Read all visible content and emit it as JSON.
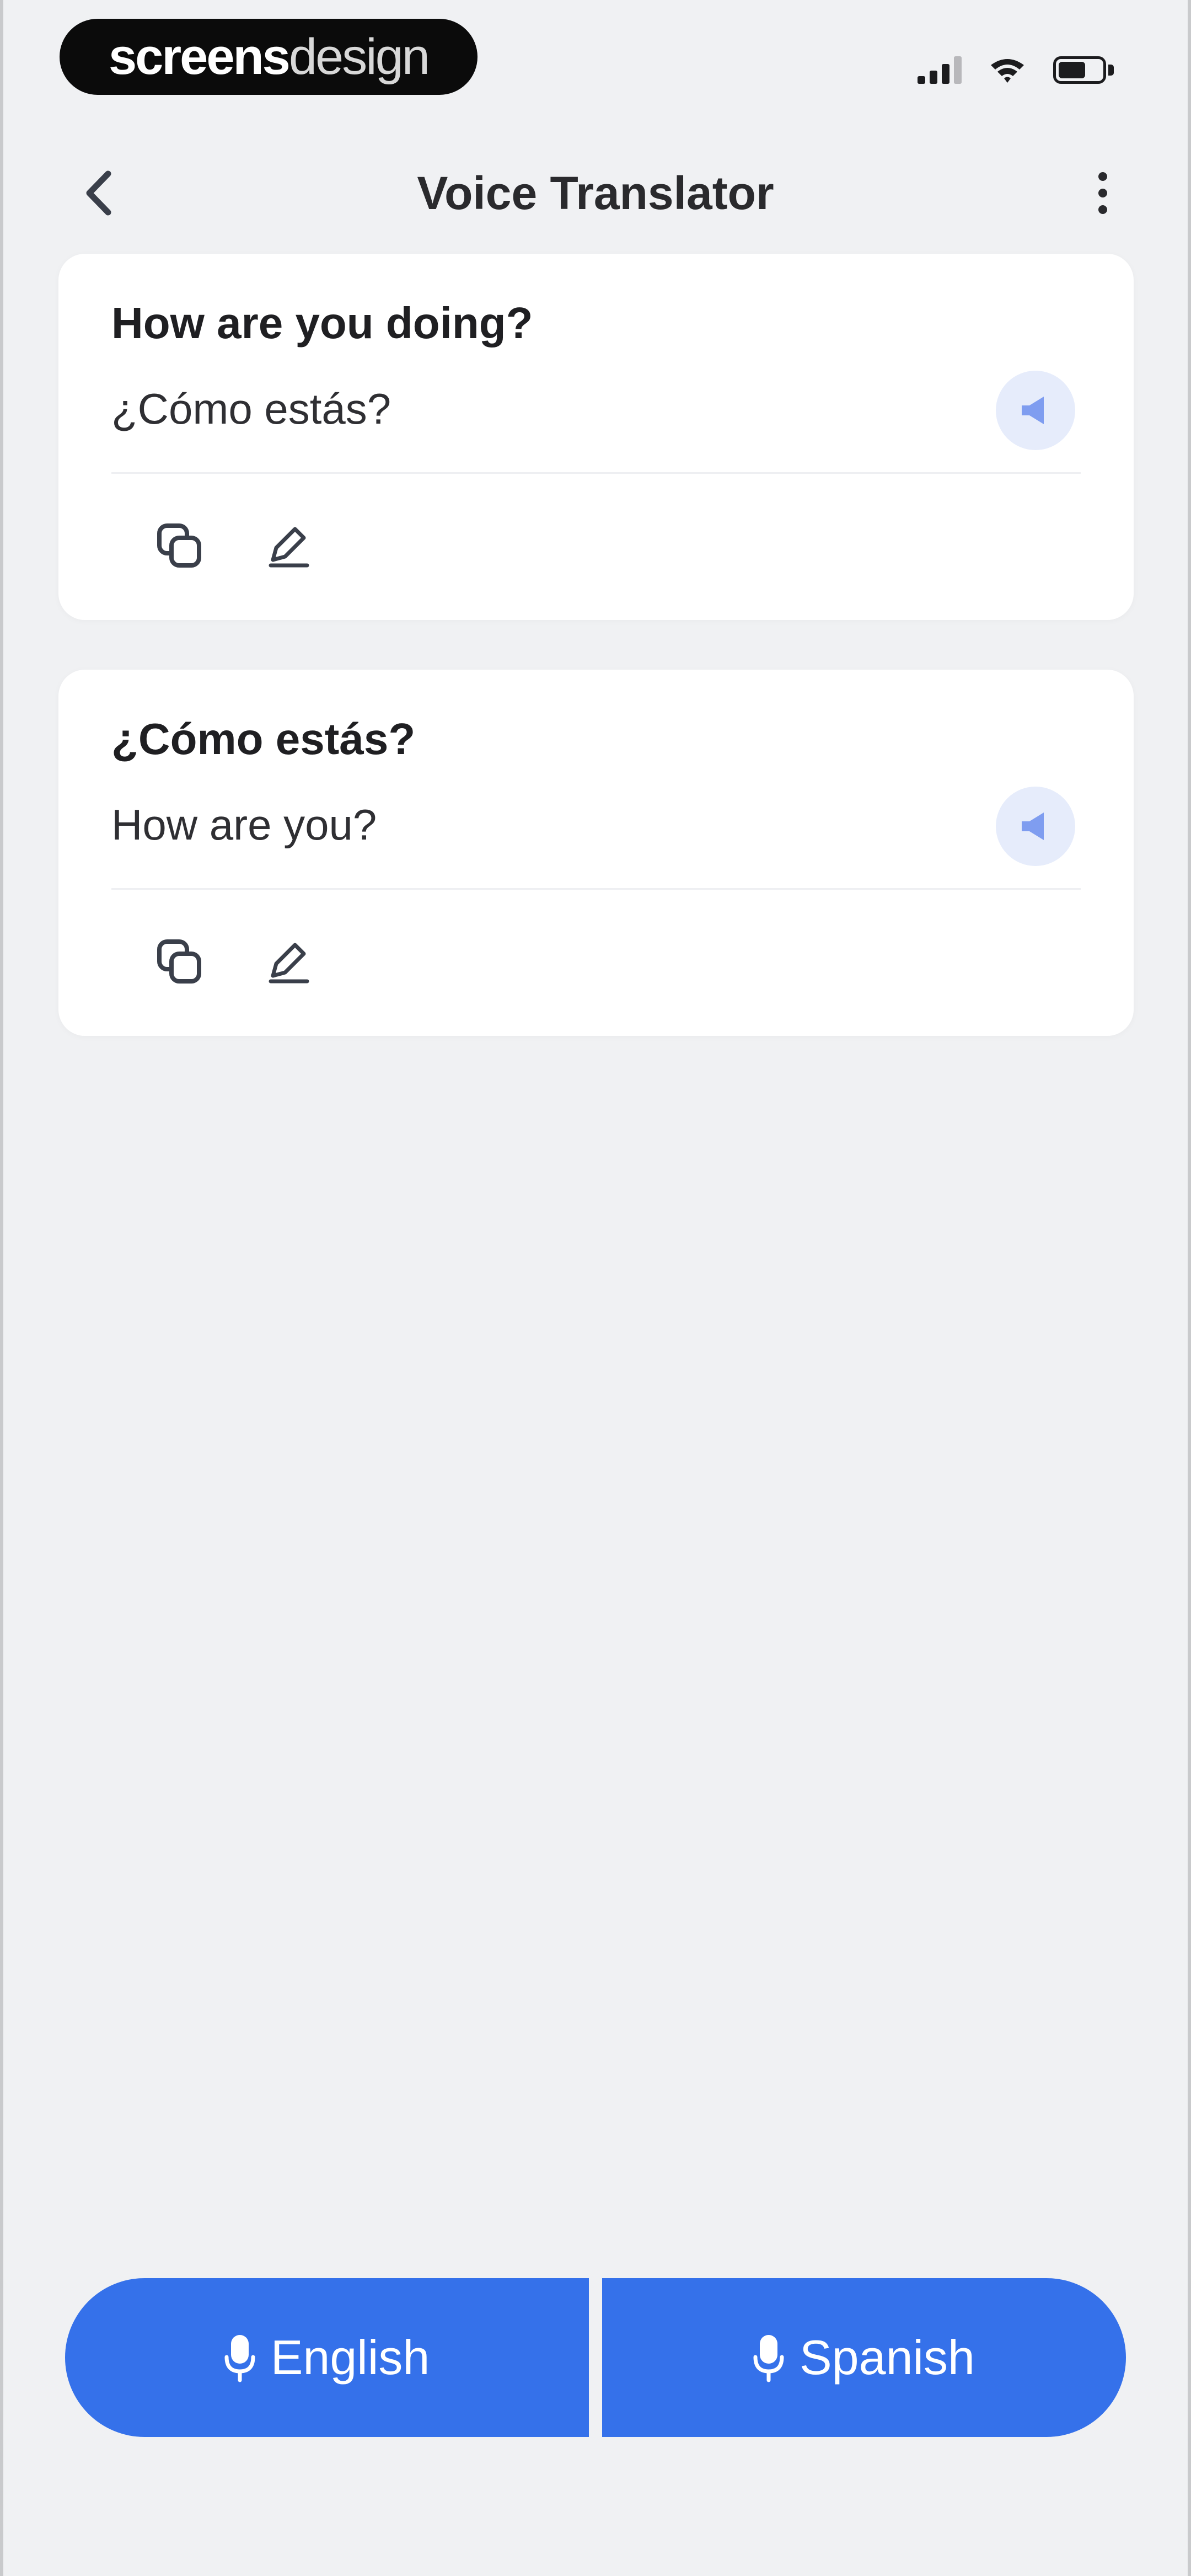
{
  "status_bar": {
    "brand_bold": "screens",
    "brand_light": "design",
    "icons": [
      "cellular-signal-icon",
      "wifi-icon",
      "battery-icon"
    ]
  },
  "nav": {
    "title": "Voice Translator",
    "back_icon": "chevron-left-icon",
    "more_icon": "more-vertical-icon"
  },
  "conversation": [
    {
      "source": "How are you doing?",
      "translation": "¿Cómo estás?",
      "actions": [
        "copy-icon",
        "edit-icon"
      ],
      "speak_icon": "speaker-icon"
    },
    {
      "source": "¿Cómo estás?",
      "translation": "How are you?",
      "actions": [
        "copy-icon",
        "edit-icon"
      ],
      "speak_icon": "speaker-icon"
    }
  ],
  "languages": {
    "left": "English",
    "right": "Spanish",
    "mic_icon": "microphone-icon"
  },
  "colors": {
    "accent": "#3571ea",
    "background": "#f0f1f3",
    "card": "#ffffff",
    "speak_bg": "#e6ecfb",
    "speak_icon": "#7f9df0"
  }
}
